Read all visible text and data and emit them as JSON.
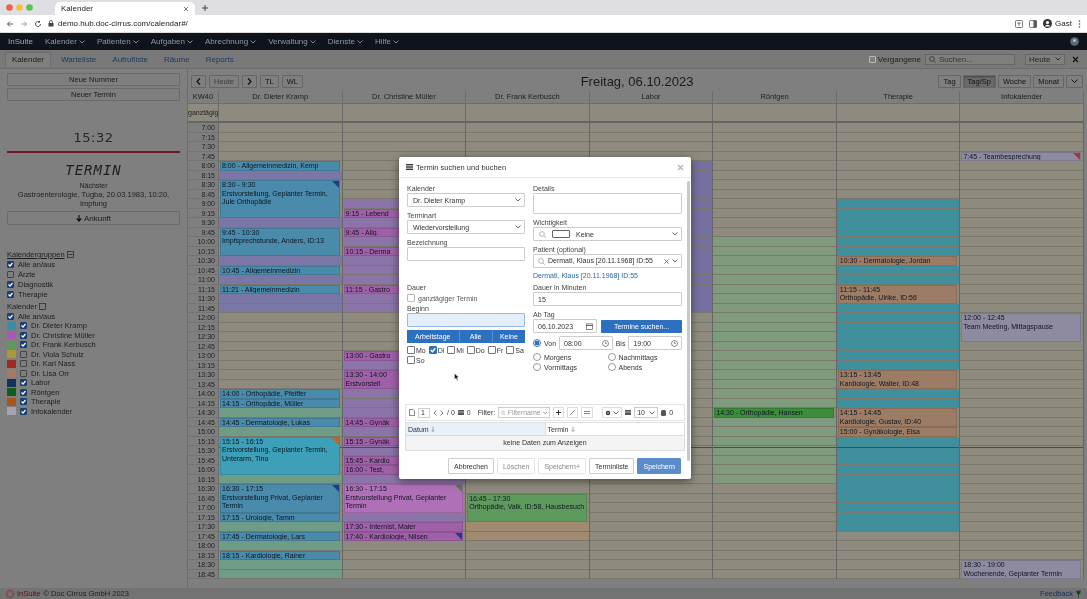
{
  "browser": {
    "tab_title": "Kalender",
    "url": "demo.hub.doc-cirrus.com/calendar#/",
    "profile": "Gast"
  },
  "app_nav": {
    "brand": "InSuite",
    "menus": [
      "Kalender",
      "Patienten",
      "Aufgaben",
      "Abrechnung",
      "Verwaltung",
      "Dienste",
      "Hilfe"
    ]
  },
  "sub_tabs": [
    {
      "label": "Kalender",
      "selected": true
    },
    {
      "label": "Warteliste",
      "selected": false
    },
    {
      "label": "Aufrufliste",
      "selected": false
    },
    {
      "label": "Räume",
      "selected": false
    },
    {
      "label": "Reports",
      "selected": false
    }
  ],
  "filter_bar": {
    "past": {
      "label": "Vergangene",
      "checked": false
    },
    "search_placeholder": "Suchen...",
    "view_select": "Heute"
  },
  "sidebar": {
    "buttons": [
      "Neue Nummer",
      "Neuer Termin"
    ],
    "clock": "15:32",
    "display": "TERMIN",
    "next_label": "Nächster",
    "next_text": "Gastroenterologie, Tugba, 20.03.1983, 10:20, Impfung",
    "arrival_button": "Ankunft",
    "groups_title": "Kalendergruppen",
    "groups": [
      {
        "label": "Alle an/aus",
        "checked": true
      },
      {
        "label": "Ärzte",
        "checked": false
      },
      {
        "label": "Diagnostik",
        "checked": true
      },
      {
        "label": "Therapie",
        "checked": true
      }
    ],
    "calendars_title": "Kalender",
    "calendars_all": {
      "label": "Alle an/aus",
      "checked": true
    },
    "calendars": [
      {
        "label": "Dr. Dieter Kramp",
        "color": "#3a8aa8",
        "checked": true
      },
      {
        "label": "Dr. Christine Müller",
        "color": "#a858b0",
        "checked": true
      },
      {
        "label": "Dr. Frank Kerbusch",
        "color": "#5a9a5a",
        "checked": true
      },
      {
        "label": "Dr. Viola Schulz",
        "color": "#a89838",
        "checked": false
      },
      {
        "label": "Dr. Karl Nass",
        "color": "#a02828",
        "checked": false
      },
      {
        "label": "Dr. Lisa Orr",
        "color": "#a87860",
        "checked": false
      },
      {
        "label": "Labor",
        "color": "#12325c",
        "checked": true
      },
      {
        "label": "Röntgen",
        "color": "#125c1c",
        "checked": true
      },
      {
        "label": "Therapie",
        "color": "#a8561c",
        "checked": true
      },
      {
        "label": "Infokalender",
        "color": "#a4a4b0",
        "checked": true
      }
    ]
  },
  "calendar": {
    "nav": [
      "Heute",
      "TL",
      "WL"
    ],
    "title": "Freitag, 06.10.2023",
    "views": [
      {
        "label": "Tag",
        "selected": false
      },
      {
        "label": "Tag/Sp",
        "selected": true
      },
      {
        "label": "Woche",
        "selected": false
      },
      {
        "label": "Monat",
        "selected": false
      }
    ],
    "week_label": "KW40",
    "allday_label": "ganztägig",
    "times": [
      "7:00",
      "7:15",
      "7:30",
      "7:45",
      "8:00",
      "8:15",
      "8:30",
      "8:45",
      "9:00",
      "9:15",
      "9:30",
      "9:45",
      "10:00",
      "10:15",
      "10:30",
      "10:45",
      "11:00",
      "11:15",
      "11:30",
      "11:45",
      "12:00",
      "12:15",
      "12:30",
      "12:45",
      "13:00",
      "13:15",
      "13:30",
      "13:45",
      "14:00",
      "14:15",
      "14:30",
      "14:45",
      "15:00",
      "15:15",
      "15:30",
      "15:45",
      "16:00",
      "16:15",
      "16:30",
      "16:45",
      "17:00",
      "17:15",
      "17:30",
      "17:45",
      "18:00",
      "18:15",
      "18:30",
      "18:45"
    ],
    "columns": [
      {
        "name": "Dr. Dieter Kramp",
        "items": [
          {
            "kind": "slot",
            "color": "#8e8b7e"
          },
          {
            "kind": "slot",
            "color": "#8e8b7e"
          },
          {
            "kind": "slot",
            "color": "#8e8b7e"
          },
          {
            "kind": "slot",
            "color": "#8e8b7e"
          },
          {
            "kind": "event",
            "color": "#4a8aaa",
            "text": "8:00 - Allgemeinmedizin, Kemp"
          },
          {
            "kind": "slot",
            "color": "#7a76a6"
          },
          {
            "kind": "event",
            "color": "#4a8aaa",
            "time": "8:30 - 9:30",
            "text": "Erstvorstellung, Geplanter Termin, Jule Orthopädie",
            "flag": {
              "color": "#1c3c8c"
            }
          },
          {
            "kind": "slot",
            "color": "#7a76a6"
          },
          {
            "kind": "event",
            "color": "#4a8aaa",
            "time": "9:45 - 10:30",
            "text": "Impfsprechstunde, Anders, ID:13"
          },
          {
            "kind": "slot",
            "color": "#7a76a6"
          },
          {
            "kind": "event",
            "color": "#4a8aaa",
            "text": "10:45 - Allgemeinmedizin"
          },
          {
            "kind": "slot",
            "color": "#7a76a6"
          },
          {
            "kind": "event",
            "color": "#4a8aaa",
            "text": "11:21 - Allgemeinmedizin"
          },
          {
            "kind": "slot",
            "color": "#7a76a6"
          },
          {
            "kind": "slot",
            "color": "#7a76a6"
          },
          {
            "kind": "slot",
            "color": "#8e8b7e"
          },
          {
            "kind": "slot",
            "color": "#8e8b7e"
          },
          {
            "kind": "slot",
            "color": "#8e8b7e"
          },
          {
            "kind": "slot",
            "color": "#8e8b7e"
          },
          {
            "kind": "slot",
            "color": "#8e8b7e"
          },
          {
            "kind": "slot",
            "color": "#8e8b7e"
          },
          {
            "kind": "slot",
            "color": "#8e8b7e"
          },
          {
            "kind": "slot",
            "color": "#8e8b7e"
          },
          {
            "kind": "event",
            "color": "#4a8aaa",
            "text": "14:00 - Orthopädie, Pfeiffer"
          },
          {
            "kind": "event",
            "color": "#4a8aaa",
            "text": "14:15 - Orthopädie, Müller"
          },
          {
            "kind": "slot",
            "color": "#6f9c86"
          },
          {
            "kind": "event",
            "color": "#4a8aaa",
            "text": "14:45 - Dermatologie, Lukas"
          },
          {
            "kind": "slot",
            "color": "#6f9c86"
          },
          {
            "kind": "event",
            "color": "#3da0b8",
            "time": "15:15 - 16:15",
            "text": "Erstvorstellung, Geplanter Termin, Unterarm, Tino",
            "flag": {
              "color": "#c06820"
            }
          },
          {
            "kind": "slot",
            "color": "#6f9c86"
          },
          {
            "kind": "event",
            "color": "#4a8aaa",
            "time": "16:30 - 17:15",
            "text": "Erstvorstellung Privat, Geplanter Termin",
            "flag": {
              "color": "#1c3c8c"
            }
          },
          {
            "kind": "event",
            "color": "#4a8aaa",
            "text": "17:15 - Urologie, Tamm"
          },
          {
            "kind": "slot",
            "color": "#6f9c86"
          },
          {
            "kind": "event",
            "color": "#4a8aaa",
            "text": "17:45 - Dermatologie, Lars"
          },
          {
            "kind": "slot",
            "color": "#6f9c86"
          },
          {
            "kind": "event",
            "color": "#4a8aaa",
            "text": "18:15 - Kardiologie, Rainer"
          },
          {
            "kind": "slot",
            "color": "#6f9c86"
          },
          {
            "kind": "slot",
            "color": "#6f9c86"
          }
        ]
      },
      {
        "name": "Dr. Christine Müller",
        "items": [
          {
            "kind": "slot",
            "color": "#8e8b7e"
          },
          {
            "kind": "slot",
            "color": "#8e8b7e"
          },
          {
            "kind": "slot",
            "color": "#8e8b7e"
          },
          {
            "kind": "slot",
            "color": "#8e8b7e"
          },
          {
            "kind": "slot",
            "color": "#8e8b7e"
          },
          {
            "kind": "slot",
            "color": "#8e8b7e"
          },
          {
            "kind": "slot",
            "color": "#8e8b7e"
          },
          {
            "kind": "slot",
            "color": "#8e8b7e"
          },
          {
            "kind": "slot",
            "color": "#8a74a8"
          },
          {
            "kind": "event",
            "color": "#a060a8",
            "text": "9:15 - Lebend"
          },
          {
            "kind": "slot",
            "color": "#8a74a8"
          },
          {
            "kind": "event",
            "color": "#a060a8",
            "text": "9:45 - Allg."
          },
          {
            "kind": "slot",
            "color": "#8a74a8"
          },
          {
            "kind": "event",
            "color": "#a060a8",
            "text": "10:15 - Derma"
          },
          {
            "kind": "slot",
            "color": "#8a74a8"
          },
          {
            "kind": "slot",
            "color": "#8a74a8"
          },
          {
            "kind": "slot",
            "color": "#8a74a8"
          },
          {
            "kind": "event",
            "color": "#a060a8",
            "text": "11:15 - Gastro"
          },
          {
            "kind": "slot",
            "color": "#8a74a8"
          },
          {
            "kind": "slot",
            "color": "#8a74a8"
          },
          {
            "kind": "slot",
            "color": "#8e8b7e"
          },
          {
            "kind": "slot",
            "color": "#8e8b7e"
          },
          {
            "kind": "slot",
            "color": "#8e8b7e"
          },
          {
            "kind": "slot",
            "color": "#8e8b7e"
          },
          {
            "kind": "event",
            "color": "#a060a8",
            "text": "13:00 - Gastro"
          },
          {
            "kind": "slot",
            "color": "#8a74a8"
          },
          {
            "kind": "event",
            "color": "#a060a8",
            "time": "13:30 - 14:00",
            "text": "Erstvorstell"
          },
          {
            "kind": "slot",
            "color": "#8a74a8"
          },
          {
            "kind": "slot",
            "color": "#8a74a8"
          },
          {
            "kind": "slot",
            "color": "#8a74a8"
          },
          {
            "kind": "event",
            "color": "#a060a8",
            "text": "14:45 - Gynäk"
          },
          {
            "kind": "slot",
            "color": "#8a74a8"
          },
          {
            "kind": "event",
            "color": "#a060a8",
            "text": "15:15 - Gynäk"
          },
          {
            "kind": "slot",
            "color": "#8a74a8"
          },
          {
            "kind": "event",
            "color": "#a060a8",
            "text": "15:45 - Kardio"
          },
          {
            "kind": "event",
            "color": "#a060a8",
            "text": "16:00 - Test,"
          },
          {
            "kind": "slot",
            "color": "#8a74a8"
          },
          {
            "kind": "event",
            "color": "#b070b8",
            "time": "16:30 - 17:15",
            "text": "Erstvorstellung Privat, Geplanter Termin",
            "flag": {
              "color": "#3c8c3c"
            }
          },
          {
            "kind": "slot",
            "color": "#8a74a8"
          },
          {
            "kind": "event",
            "color": "#a060a8",
            "text": "17:30 - Internist, Maier"
          },
          {
            "kind": "event",
            "color": "#a060a8",
            "text": "17:40 - Kardiologie, Nilsen",
            "flag": {
              "color": "#1c3c8c"
            }
          },
          {
            "kind": "slot",
            "color": "#8e8b7e"
          },
          {
            "kind": "slot",
            "color": "#8e8b7e"
          },
          {
            "kind": "slot",
            "color": "#8e8b7e"
          },
          {
            "kind": "slot",
            "color": "#8e8b7e"
          }
        ]
      },
      {
        "name": "Dr. Frank Kerbusch",
        "items": [
          {
            "kind": "slot",
            "color": "#8e8b7e"
          },
          {
            "kind": "slot",
            "color": "#8e8b7e"
          },
          {
            "kind": "slot",
            "color": "#8e8b7e"
          },
          {
            "kind": "filler",
            "color": "#8e8b7e"
          },
          {
            "kind": "event",
            "color": "#5e9a5e",
            "time": "16:45 - 17:30",
            "text": "Orthopädie, Valk, ID:58, Hausbesuch"
          },
          {
            "kind": "slot",
            "color": "#a08a70"
          },
          {
            "kind": "slot",
            "color": "#a08a70"
          },
          {
            "kind": "slot",
            "color": "#8e8b7e"
          },
          {
            "kind": "slot",
            "color": "#8e8b7e"
          },
          {
            "kind": "slot",
            "color": "#8e8b7e"
          },
          {
            "kind": "slot",
            "color": "#8e8b7e"
          }
        ]
      },
      {
        "name": "Labor",
        "items": [
          {
            "kind": "slot",
            "color": "#8e8b7e"
          },
          {
            "kind": "slot",
            "color": "#8e8b7e"
          },
          {
            "kind": "slot",
            "color": "#8e8b7e"
          },
          {
            "kind": "slot",
            "color": "#8e8b7e"
          },
          {
            "kind": "slot",
            "color": "#75709f"
          },
          {
            "kind": "slot",
            "color": "#75709f"
          },
          {
            "kind": "slot",
            "color": "#75709f"
          },
          {
            "kind": "slot",
            "color": "#75709f"
          },
          {
            "kind": "slot",
            "color": "#75709f"
          },
          {
            "kind": "slot",
            "color": "#75709f"
          },
          {
            "kind": "slot",
            "color": "#75709f"
          },
          {
            "kind": "slot",
            "color": "#75709f"
          },
          {
            "kind": "slot",
            "color": "#75709f"
          },
          {
            "kind": "slot",
            "color": "#75709f"
          },
          {
            "kind": "slot",
            "color": "#75709f"
          },
          {
            "kind": "slot",
            "color": "#75709f"
          },
          {
            "kind": "slot",
            "color": "#75709f"
          },
          {
            "kind": "slot",
            "color": "#75709f"
          },
          {
            "kind": "slot",
            "color": "#75709f"
          },
          {
            "kind": "slot",
            "color": "#75709f"
          },
          {
            "kind": "slot",
            "color": "#8e8b7e"
          },
          {
            "kind": "slot",
            "color": "#8e8b7e"
          },
          {
            "kind": "slot",
            "color": "#8e8b7e"
          },
          {
            "kind": "slot",
            "color": "#8e8b7e"
          },
          {
            "kind": "slot",
            "color": "#8e8b7e"
          },
          {
            "kind": "slot",
            "color": "#8e8b7e"
          },
          {
            "kind": "slot",
            "color": "#8e8b7e"
          },
          {
            "kind": "slot",
            "color": "#8e8b7e"
          },
          {
            "kind": "slot",
            "color": "#8e8b7e"
          },
          {
            "kind": "slot",
            "color": "#8e8b7e"
          },
          {
            "kind": "slot",
            "color": "#8e8b7e"
          },
          {
            "kind": "slot",
            "color": "#8e8b7e"
          },
          {
            "kind": "slot",
            "color": "#8e8b7e"
          },
          {
            "kind": "slot",
            "color": "#8e8b7e"
          },
          {
            "kind": "slot",
            "color": "#8e8b7e"
          },
          {
            "kind": "slot",
            "color": "#8e8b7e"
          },
          {
            "kind": "slot",
            "color": "#8e8b7e"
          },
          {
            "kind": "slot",
            "color": "#8e8b7e"
          },
          {
            "kind": "slot",
            "color": "#8e8b7e"
          },
          {
            "kind": "slot",
            "color": "#8e8b7e"
          },
          {
            "kind": "slot",
            "color": "#8e8b7e"
          },
          {
            "kind": "slot",
            "color": "#8e8b7e"
          },
          {
            "kind": "slot",
            "color": "#8e8b7e"
          },
          {
            "kind": "slot",
            "color": "#8e8b7e"
          },
          {
            "kind": "slot",
            "color": "#8e8b7e"
          },
          {
            "kind": "slot",
            "color": "#8e8b7e"
          },
          {
            "kind": "slot",
            "color": "#8e8b7e"
          },
          {
            "kind": "slot",
            "color": "#8e8b7e"
          }
        ]
      },
      {
        "name": "Röntgen",
        "items": [
          {
            "kind": "slot",
            "color": "#8e8b7e"
          },
          {
            "kind": "slot",
            "color": "#8e8b7e"
          },
          {
            "kind": "slot",
            "color": "#8e8b7e"
          },
          {
            "kind": "slot",
            "color": "#8e8b7e"
          },
          {
            "kind": "slot",
            "color": "#8e8b7e"
          },
          {
            "kind": "slot",
            "color": "#8e8b7e"
          },
          {
            "kind": "slot",
            "color": "#8e8b7e"
          },
          {
            "kind": "slot",
            "color": "#8e8b7e"
          },
          {
            "kind": "slot",
            "color": "#8e8b7e"
          },
          {
            "kind": "slot",
            "color": "#8e8b7e"
          },
          {
            "kind": "slot",
            "color": "#8e8b7e"
          },
          {
            "kind": "slot",
            "color": "#8e8b7e"
          },
          {
            "kind": "slot",
            "color": "#7f9a7c"
          },
          {
            "kind": "slot",
            "color": "#7f9a7c"
          },
          {
            "kind": "slot",
            "color": "#7f9a7c"
          },
          {
            "kind": "slot",
            "color": "#7f9a7c"
          },
          {
            "kind": "slot",
            "color": "#7f9a7c"
          },
          {
            "kind": "slot",
            "color": "#7f9a7c"
          },
          {
            "kind": "slot",
            "color": "#7f9a7c"
          },
          {
            "kind": "slot",
            "color": "#7f9a7c"
          },
          {
            "kind": "slot",
            "color": "#7f9a7c"
          },
          {
            "kind": "slot",
            "color": "#7f9a7c"
          },
          {
            "kind": "slot",
            "color": "#7f9a7c"
          },
          {
            "kind": "slot",
            "color": "#7f9a7c"
          },
          {
            "kind": "slot",
            "color": "#7f9a7c"
          },
          {
            "kind": "slot",
            "color": "#7f9a7c"
          },
          {
            "kind": "slot",
            "color": "#7f9a7c"
          },
          {
            "kind": "slot",
            "color": "#7f9a7c"
          },
          {
            "kind": "slot",
            "color": "#7f9a7c"
          },
          {
            "kind": "slot",
            "color": "#7f9a7c"
          },
          {
            "kind": "event",
            "color": "#3c8c3c",
            "text": "14:30 - Orthopädie, Hansen"
          },
          {
            "kind": "slot",
            "color": "#7f9a7c"
          },
          {
            "kind": "slot",
            "color": "#7f9a7c"
          },
          {
            "kind": "slot",
            "color": "#7f9a7c"
          },
          {
            "kind": "slot",
            "color": "#7f9a7c"
          },
          {
            "kind": "slot",
            "color": "#7f9a7c"
          },
          {
            "kind": "slot",
            "color": "#7f9a7c"
          },
          {
            "kind": "slot",
            "color": "#7f9a7c"
          },
          {
            "kind": "slot",
            "color": "#8e8b7e"
          },
          {
            "kind": "slot",
            "color": "#8e8b7e"
          },
          {
            "kind": "slot",
            "color": "#8e8b7e"
          },
          {
            "kind": "slot",
            "color": "#8e8b7e"
          },
          {
            "kind": "slot",
            "color": "#8e8b7e"
          },
          {
            "kind": "slot",
            "color": "#8e8b7e"
          },
          {
            "kind": "slot",
            "color": "#8e8b7e"
          },
          {
            "kind": "slot",
            "color": "#8e8b7e"
          },
          {
            "kind": "slot",
            "color": "#8e8b7e"
          },
          {
            "kind": "slot",
            "color": "#8e8b7e"
          }
        ]
      },
      {
        "name": "Therapie",
        "items": [
          {
            "kind": "slot",
            "color": "#8e8b7e"
          },
          {
            "kind": "slot",
            "color": "#8e8b7e"
          },
          {
            "kind": "slot",
            "color": "#8e8b7e"
          },
          {
            "kind": "slot",
            "color": "#8e8b7e"
          },
          {
            "kind": "slot",
            "color": "#8e8b7e"
          },
          {
            "kind": "slot",
            "color": "#8e8b7e"
          },
          {
            "kind": "slot",
            "color": "#8e8b7e"
          },
          {
            "kind": "slot",
            "color": "#8e8b7e"
          },
          {
            "kind": "slot",
            "color": "#3f8f9c"
          },
          {
            "kind": "slot",
            "color": "#3f8f9c"
          },
          {
            "kind": "slot",
            "color": "#3f8f9c"
          },
          {
            "kind": "slot",
            "color": "#3f8f9c"
          },
          {
            "kind": "slot",
            "color": "#3f8f9c"
          },
          {
            "kind": "slot",
            "color": "#3f8f9c"
          },
          {
            "kind": "event",
            "color": "#9c7c64",
            "text": "10:30 - Dermatologie, Jordan"
          },
          {
            "kind": "slot",
            "color": "#3f8f9c"
          },
          {
            "kind": "slot",
            "color": "#3f8f9c"
          },
          {
            "kind": "event",
            "color": "#9c7c64",
            "time": "11:15 - 11:45",
            "text": "Orthopädie, Ulrike, ID:56"
          },
          {
            "kind": "slot",
            "color": "#3f8f9c"
          },
          {
            "kind": "slot",
            "color": "#3f8f9c"
          },
          {
            "kind": "slot",
            "color": "#3f8f9c"
          },
          {
            "kind": "slot",
            "color": "#3f8f9c"
          },
          {
            "kind": "slot",
            "color": "#3f8f9c"
          },
          {
            "kind": "slot",
            "color": "#3f8f9c"
          },
          {
            "kind": "slot",
            "color": "#3f8f9c"
          },
          {
            "kind": "event",
            "color": "#9c7c64",
            "time": "13:15 - 13:45",
            "text": "Kardiologie, Walter, ID:48"
          },
          {
            "kind": "slot",
            "color": "#3f8f9c"
          },
          {
            "kind": "slot",
            "color": "#3f8f9c"
          },
          {
            "kind": "event",
            "color": "#9c7c64",
            "time": "14:15 - 14:45",
            "text": "Kardiologie, Gustav, ID:40"
          },
          {
            "kind": "event",
            "color": "#9c7c64",
            "text": "15:00 - Gynäkologie, Elsa"
          },
          {
            "kind": "slot",
            "color": "#3f8f9c"
          },
          {
            "kind": "slot",
            "color": "#3f8f9c"
          },
          {
            "kind": "slot",
            "color": "#3f8f9c"
          },
          {
            "kind": "slot",
            "color": "#3f8f9c"
          },
          {
            "kind": "slot",
            "color": "#3f8f9c"
          },
          {
            "kind": "slot",
            "color": "#3f8f9c"
          },
          {
            "kind": "slot",
            "color": "#3f8f9c"
          },
          {
            "kind": "slot",
            "color": "#3f8f9c"
          },
          {
            "kind": "slot",
            "color": "#3f8f9c"
          },
          {
            "kind": "slot",
            "color": "#3f8f9c"
          },
          {
            "kind": "slot",
            "color": "#8e8b7e"
          },
          {
            "kind": "slot",
            "color": "#8e8b7e"
          },
          {
            "kind": "slot",
            "color": "#8e8b7e"
          },
          {
            "kind": "slot",
            "color": "#8e8b7e"
          },
          {
            "kind": "slot",
            "color": "#8e8b7e"
          }
        ]
      },
      {
        "name": "Infokalender",
        "items": [
          {
            "kind": "slot",
            "color": "#8e8b7e"
          },
          {
            "kind": "slot",
            "color": "#8e8b7e"
          },
          {
            "kind": "slot",
            "color": "#8e8b7e"
          },
          {
            "kind": "event",
            "color": "#8e8aa0",
            "text": "7:45 - Teambesprechung",
            "flag": {
              "color": "#a83838"
            }
          },
          {
            "kind": "slot",
            "color": "#8e8b7e"
          },
          {
            "kind": "slot",
            "color": "#8e8b7e"
          },
          {
            "kind": "slot",
            "color": "#8e8b7e"
          },
          {
            "kind": "slot",
            "color": "#8e8b7e"
          },
          {
            "kind": "slot",
            "color": "#8e8b7e"
          },
          {
            "kind": "slot",
            "color": "#8e8b7e"
          },
          {
            "kind": "slot",
            "color": "#8e8b7e"
          },
          {
            "kind": "slot",
            "color": "#8e8b7e"
          },
          {
            "kind": "slot",
            "color": "#8e8b7e"
          },
          {
            "kind": "slot",
            "color": "#8e8b7e"
          },
          {
            "kind": "slot",
            "color": "#8e8b7e"
          },
          {
            "kind": "slot",
            "color": "#8e8b7e"
          },
          {
            "kind": "slot",
            "color": "#8e8b7e"
          },
          {
            "kind": "slot",
            "color": "#8e8b7e"
          },
          {
            "kind": "slot",
            "color": "#8e8b7e"
          },
          {
            "kind": "slot",
            "color": "#8e8b7e"
          },
          {
            "kind": "event",
            "color": "#8e8aa0",
            "time": "12:00 - 12:45",
            "text": "Team Meeting, Mittagspause"
          },
          {
            "kind": "slot",
            "color": "#8e8b7e"
          },
          {
            "kind": "slot",
            "color": "#8e8b7e"
          },
          {
            "kind": "slot",
            "color": "#8e8b7e"
          },
          {
            "kind": "slot",
            "color": "#8e8b7e"
          },
          {
            "kind": "slot",
            "color": "#8e8b7e"
          },
          {
            "kind": "slot",
            "color": "#8e8b7e"
          },
          {
            "kind": "slot",
            "color": "#8e8b7e"
          },
          {
            "kind": "slot",
            "color": "#8e8b7e"
          },
          {
            "kind": "slot",
            "color": "#8e8b7e"
          },
          {
            "kind": "slot",
            "color": "#8e8b7e"
          },
          {
            "kind": "slot",
            "color": "#8e8b7e"
          },
          {
            "kind": "slot",
            "color": "#8e8b7e"
          },
          {
            "kind": "slot",
            "color": "#8e8b7e"
          },
          {
            "kind": "slot",
            "color": "#8e8b7e"
          },
          {
            "kind": "slot",
            "color": "#8e8b7e"
          },
          {
            "kind": "slot",
            "color": "#8e8b7e"
          },
          {
            "kind": "slot",
            "color": "#8e8b7e"
          },
          {
            "kind": "slot",
            "color": "#8e8b7e"
          },
          {
            "kind": "slot",
            "color": "#8e8b7e"
          },
          {
            "kind": "slot",
            "color": "#8e8b7e"
          },
          {
            "kind": "slot",
            "color": "#8e8b7e"
          },
          {
            "kind": "slot",
            "color": "#8e8b7e"
          },
          {
            "kind": "slot",
            "color": "#8e8b7e"
          },
          {
            "kind": "event",
            "color": "#8e8aa0",
            "time": "18:30 - 19:00",
            "text": "Wochenende, Geplanter Termin"
          }
        ]
      }
    ]
  },
  "dialog": {
    "title": "Termin suchen und buchen",
    "calendar": {
      "label": "Kalender",
      "value": "Dr. Dieter Kramp"
    },
    "type": {
      "label": "Terminart",
      "value": "Wiedervorstellung"
    },
    "name_field": {
      "label": "Bezeichnung"
    },
    "duration_label": "Dauer",
    "all_day": {
      "label": "ganztägiger Termin",
      "checked": false
    },
    "begin": {
      "label": "Beginn"
    },
    "day_buttons": [
      "Arbeitstage",
      "Alle",
      "Keine"
    ],
    "days": [
      {
        "label": "Mo",
        "checked": false
      },
      {
        "label": "Di",
        "checked": true
      },
      {
        "label": "Mi",
        "checked": false
      },
      {
        "label": "Do",
        "checked": false
      },
      {
        "label": "Fr",
        "checked": false
      },
      {
        "label": "Sa",
        "checked": false
      },
      {
        "label": "So",
        "checked": false
      }
    ],
    "details": {
      "label": "Details"
    },
    "importance": {
      "label": "Wichtigkeit",
      "value": "Keine"
    },
    "patient": {
      "label": "Patient (optional)",
      "value": "Dermati, Klaus [20.11.1968] ID:55",
      "link": "Dermati, Klaus [20.11.1968] ID:55"
    },
    "minutes": {
      "label": "Dauer in Minuten",
      "value": "15"
    },
    "from_day": {
      "label": "Ab Tag",
      "value": "06.10.2023",
      "button": "Termine suchen..."
    },
    "time_range": {
      "from_label": "Von",
      "from": "08:00",
      "to_label": "Bis",
      "to": "19:00",
      "selected": true
    },
    "periods": [
      {
        "label": "Morgens",
        "selected": false
      },
      {
        "label": "Nachmittags",
        "selected": false
      },
      {
        "label": "Vormittags",
        "selected": false
      },
      {
        "label": "Abends",
        "selected": false
      }
    ],
    "table_toolbar": {
      "page": "1",
      "pages": "/ 0",
      "count": "0",
      "filter_label": "Filter:",
      "filter_placeholder": "Filtername",
      "page_size": "10",
      "total": "0"
    },
    "table": {
      "columns": [
        "Datum",
        "Termin"
      ],
      "empty": "keine Daten zum Anzeigen"
    },
    "buttons": [
      {
        "label": "Abbrechen",
        "kind": "default",
        "disabled": false
      },
      {
        "label": "Löschen",
        "kind": "default",
        "disabled": true
      },
      {
        "label": "Speichern+",
        "kind": "default",
        "disabled": true
      },
      {
        "label": "Terminliste",
        "kind": "default",
        "disabled": false
      },
      {
        "label": "Speichern",
        "kind": "primary",
        "disabled": true
      }
    ]
  },
  "footer": {
    "brand": "InSuite",
    "text": "© Doc Cirrus GmbH 2023",
    "feedback": "Feedback"
  }
}
